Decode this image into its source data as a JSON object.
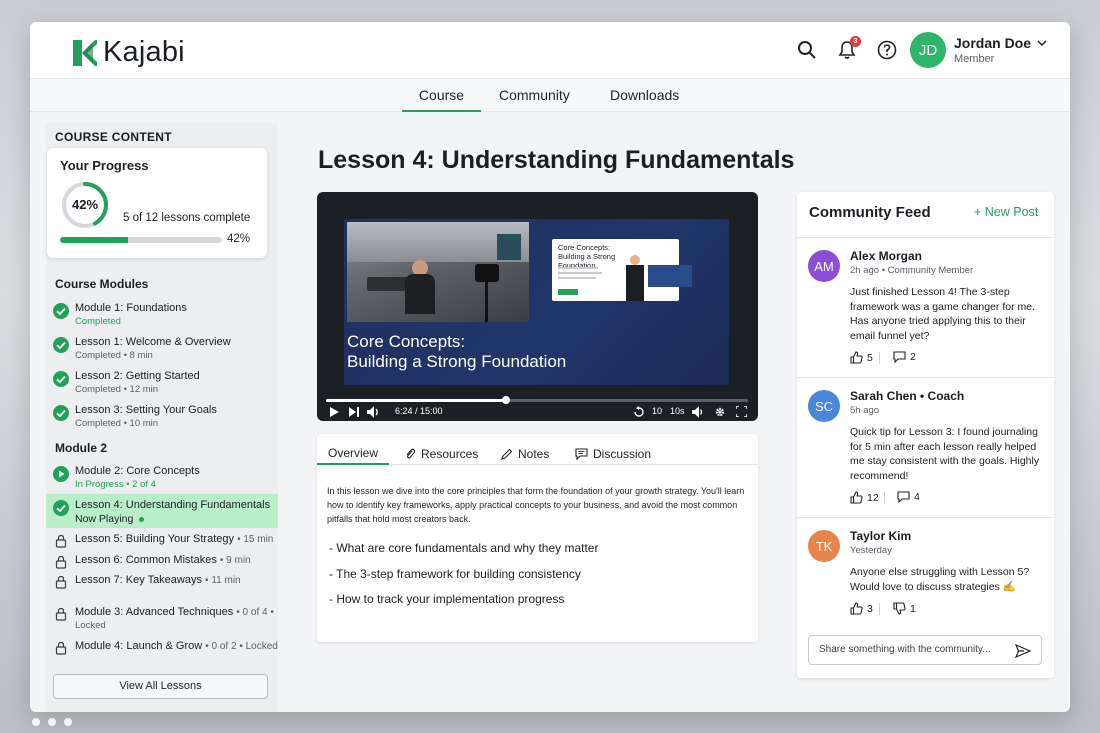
{
  "app": {
    "brand": "Kajabi",
    "brand_color": "#22a15a"
  },
  "header": {
    "notification_count": "3",
    "user": {
      "initials": "JD",
      "name": "Jordan Doe",
      "role": "Member"
    }
  },
  "nav": {
    "tabs": [
      {
        "label": "Course",
        "active": true
      },
      {
        "label": "Community"
      },
      {
        "label": "Downloads"
      }
    ]
  },
  "sidebar": {
    "header": "COURSE CONTENT",
    "progress": {
      "title": "Your Progress",
      "ring_label": "42%",
      "percent": 42,
      "count_text": "5 of 12 lessons complete",
      "bar_label": "42%"
    },
    "modules_title": "Course Modules",
    "items": [
      {
        "title": "Module 1: Foundations",
        "sub": "Completed",
        "status": "done",
        "sub_green": true
      },
      {
        "title": "Lesson 1: Welcome & Overview",
        "sub": "Completed • 8 min",
        "status": "done"
      },
      {
        "title": "Lesson 2: Getting Started",
        "sub": "Completed • 12 min",
        "status": "done"
      },
      {
        "title": "Lesson 3: Setting Your Goals",
        "sub": "Completed • 10 min",
        "status": "done"
      }
    ],
    "module2_title": "Module 2",
    "module2_items": [
      {
        "title": "Module 2: Core Concepts",
        "sub": "In Progress • 2 of 4",
        "status": "playing",
        "sub_green": true
      },
      {
        "title": "Lesson 4: Understanding Fundamentals",
        "sub": "Now Playing",
        "status": "done"
      },
      {
        "title": "Lesson 5: Building Your Strategy",
        "meta": "• 15 min",
        "status": "locked"
      },
      {
        "title": "Lesson 6: Common Mistakes",
        "meta": "• 9 min",
        "status": "locked"
      },
      {
        "title": "Lesson 7: Key Takeaways",
        "meta": "• 11 min",
        "status": "locked"
      },
      {
        "title": "Module 3: Advanced Techniques",
        "meta": "• 0 of 4 •",
        "sub": "Locked",
        "status": "locked"
      },
      {
        "title": "Module 4: Launch & Grow",
        "meta": "• 0 of 2 • Locked",
        "status": "locked"
      }
    ],
    "view_all": "View All Lessons"
  },
  "main": {
    "lesson_title": "Lesson 4: Understanding Fundamentals",
    "video": {
      "slide_title": "Core Concepts: Building a Strong Foundation",
      "caption_line1": "Core Concepts:",
      "caption_line2": "Building a Strong Foundation",
      "time": "6:24 / 15:00",
      "progress": 0.427,
      "rewind_label": "10",
      "forward_label": "10s"
    },
    "tabs": [
      "Overview",
      "Resources",
      "Notes",
      "Discussion"
    ],
    "overview_text": "In this lesson we dive into the core principles that form the foundation of your growth strategy. You'll learn how to identify key frameworks, apply practical concepts to your business, and avoid the most common pitfalls that hold most creators back.",
    "bullets": [
      "- What are core fundamentals and why they matter",
      "- The 3-step framework for building consistency",
      "- How to track your implementation progress"
    ]
  },
  "community": {
    "title": "Community Feed",
    "new_post": "+ New Post",
    "posts": [
      {
        "initials": "AM",
        "color": "#8a4fd6",
        "name": "Alex Morgan",
        "meta": "2h ago • Community Member",
        "body": "Just finished Lesson 4! The 3-step framework was a game changer for me. Has anyone tried applying this to their email funnel yet?",
        "likes": "5",
        "comments": "2"
      },
      {
        "initials": "SC",
        "color": "#4a86d9",
        "name": "Sarah Chen • Coach",
        "meta": "5h ago",
        "body": "Quick tip for Lesson 3: I found journaling for 5 min after each lesson really helped me stay consistent with the goals. Highly recommend!",
        "likes": "12",
        "comments": "4"
      },
      {
        "initials": "TK",
        "color": "#e8844a",
        "name": "Taylor Kim",
        "meta": "Yesterday",
        "body": "Anyone else struggling with Lesson 5? Would love to discuss strategies ✍",
        "likes": "3",
        "comments": "1"
      }
    ],
    "share_placeholder": "Share something with the community..."
  }
}
